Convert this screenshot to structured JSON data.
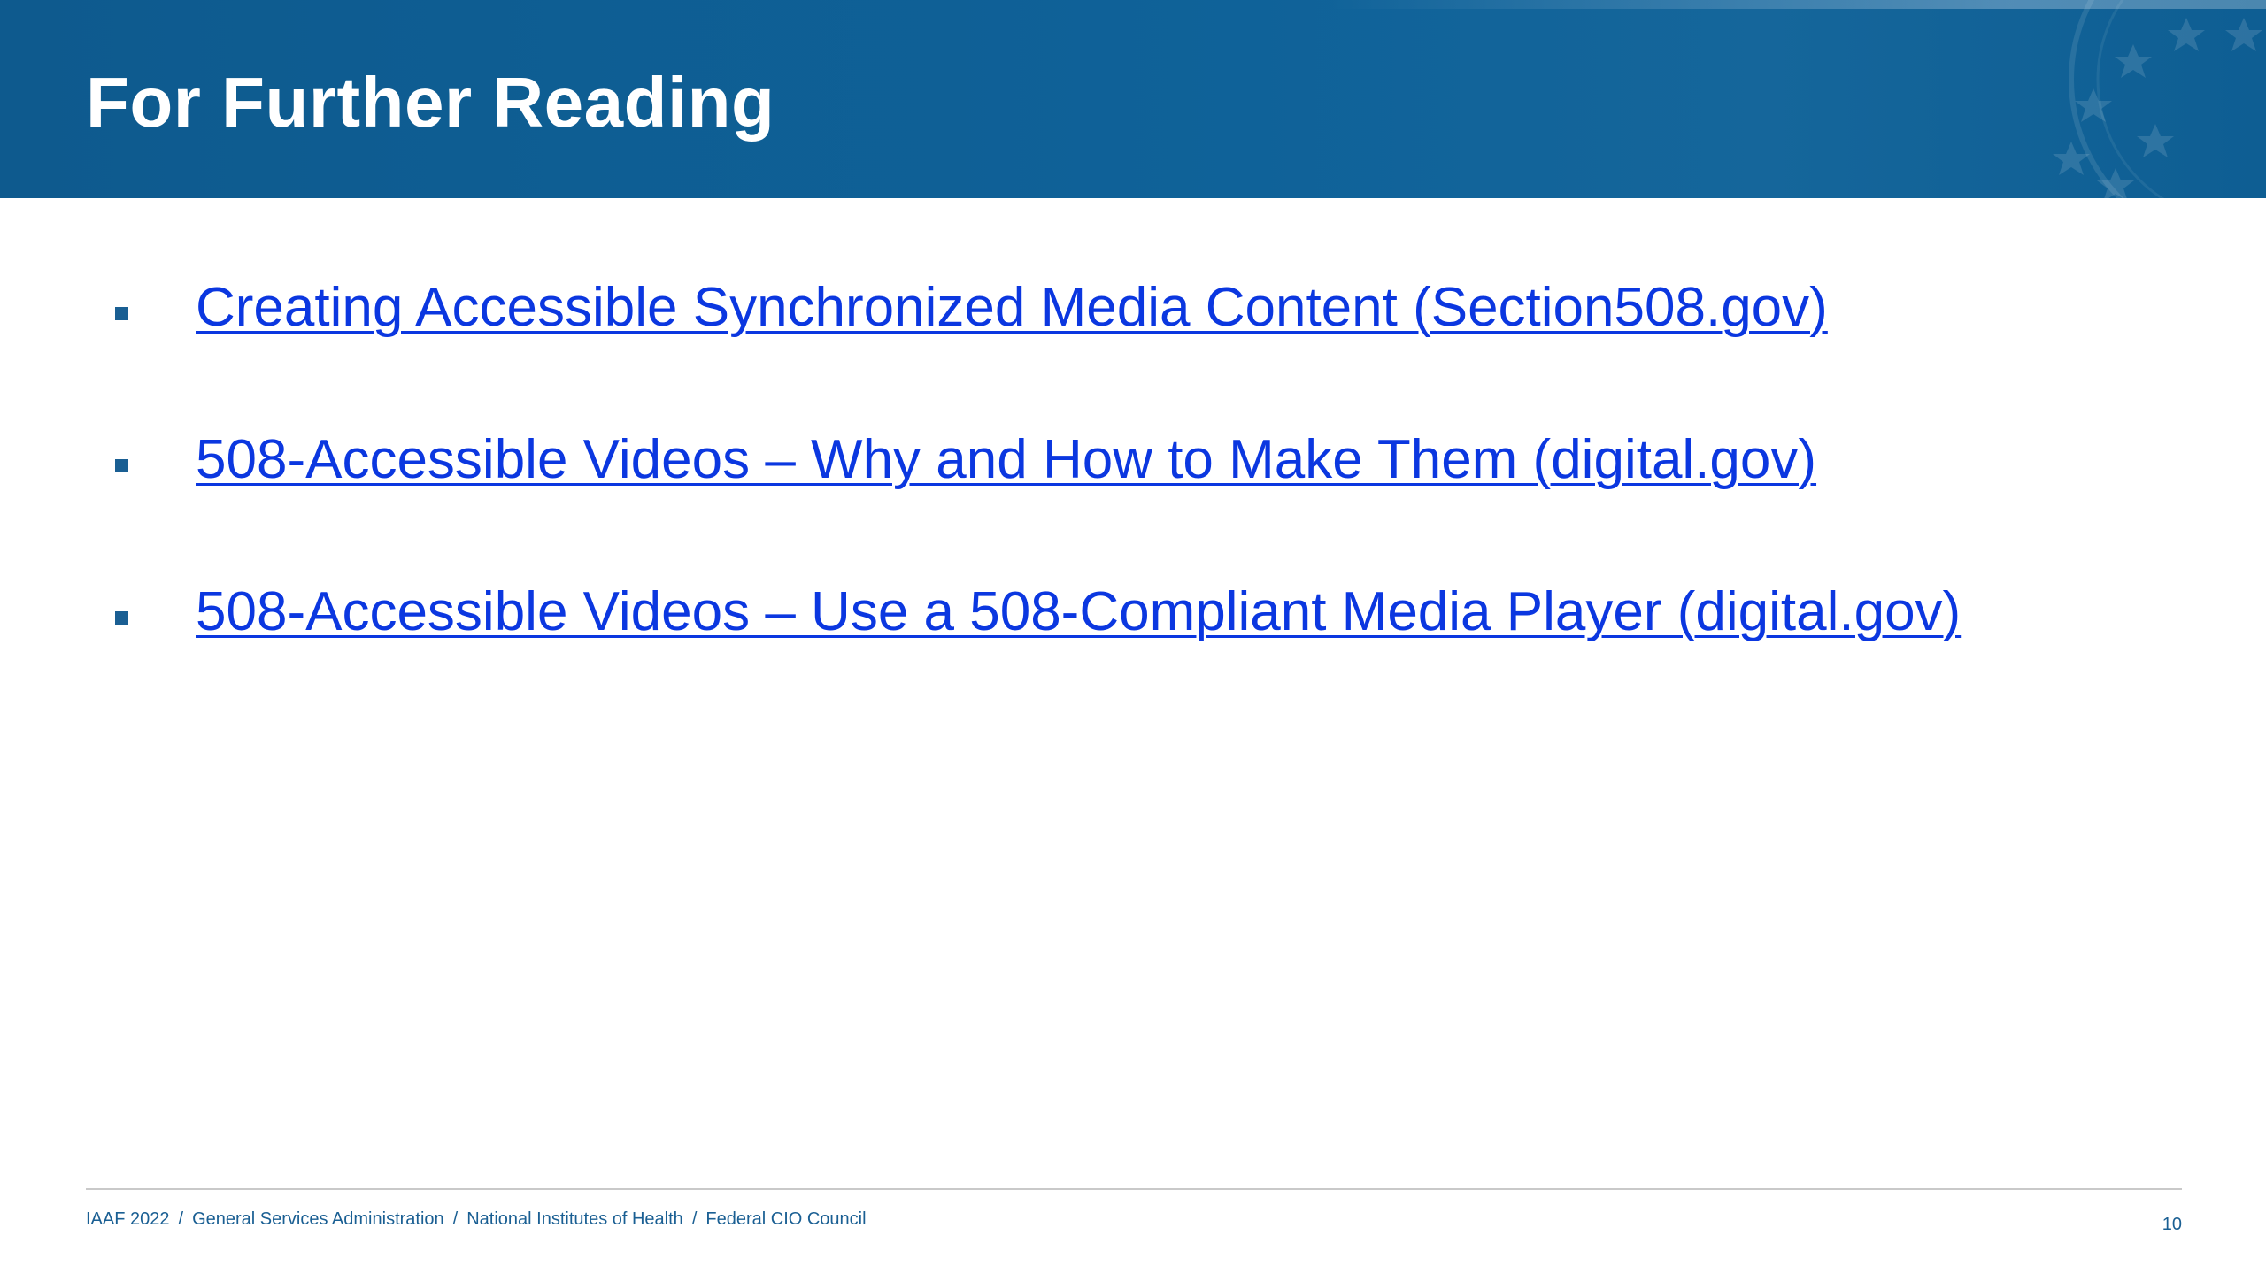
{
  "slide": {
    "title": "For Further Reading",
    "links": [
      {
        "label": "Creating Accessible Synchronized Media Content (Section508.gov)"
      },
      {
        "label": "508-Accessible Videos – Why and How to Make Them (digital.gov)"
      },
      {
        "label": "508-Accessible Videos – Use a 508-Compliant Media Player (digital.gov)"
      }
    ],
    "footer": {
      "items": [
        "IAAF 2022",
        "General Services Administration",
        "National Institutes of Health",
        "Federal CIO Council"
      ],
      "separator": "/",
      "page_number": "10"
    }
  },
  "colors": {
    "header_blue": "#0f6299",
    "link_blue": "#0b37e0",
    "footer_blue": "#1a5f93",
    "bullet_blue": "#1a5f93"
  }
}
